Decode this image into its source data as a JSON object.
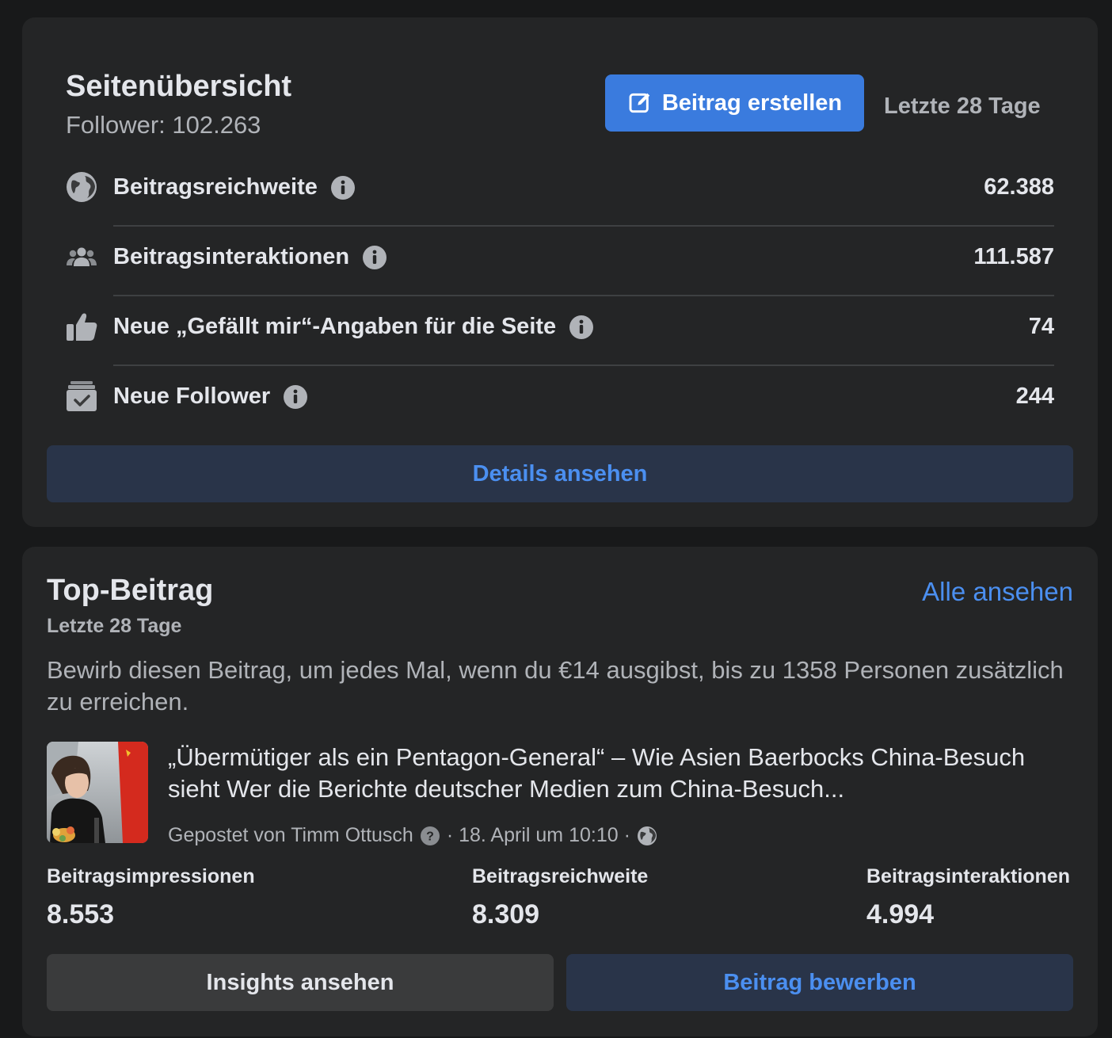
{
  "overview": {
    "title": "Seitenübersicht",
    "followers": "Follower: 102.263",
    "create_button": "Beitrag erstellen",
    "period": "Letzte 28 Tage",
    "metrics": [
      {
        "label": "Beitragsreichweite",
        "value": "62.388",
        "icon": "globe-icon"
      },
      {
        "label": "Beitragsinteraktionen",
        "value": "111.587",
        "icon": "people-icon"
      },
      {
        "label": "Neue „Gefällt mir“-Angaben für die Seite",
        "value": "74",
        "icon": "thumbs-up-icon"
      },
      {
        "label": "Neue Follower",
        "value": "244",
        "icon": "follow-box-icon"
      }
    ],
    "details_button": "Details ansehen"
  },
  "top_post": {
    "title": "Top-Beitrag",
    "see_all": "Alle ansehen",
    "period": "Letzte 28 Tage",
    "promo_text": "Bewirb diesen Beitrag, um jedes Mal, wenn du €14 ausgibst, bis zu 1358 Personen zusätzlich zu erreichen.",
    "post_text": "„Übermütiger als ein Pentagon-General“ – Wie Asien Baerbocks China-Besuch sieht Wer die Berichte deutscher Medien zum China-Besuch...",
    "posted_by": "Gepostet von Timm Ottusch",
    "date": "· 18. April um 10:10 ·",
    "stats": [
      {
        "label": "Beitragsimpressionen",
        "value": "8.553"
      },
      {
        "label": "Beitragsreichweite",
        "value": "8.309"
      },
      {
        "label": "Beitragsinteraktionen",
        "value": "4.994"
      }
    ],
    "insights_button": "Insights ansehen",
    "promote_button": "Beitrag bewerben"
  },
  "colors": {
    "background": "#18191a",
    "card": "#242526",
    "primary_button": "#3a7bde",
    "link": "#4b8ff0",
    "secondary_text": "#b0b3b8"
  }
}
